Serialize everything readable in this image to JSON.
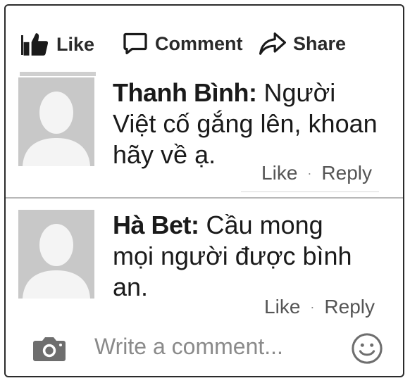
{
  "actions": {
    "like_label": "Like",
    "comment_label": "Comment",
    "share_label": "Share"
  },
  "comments": [
    {
      "author": "Thanh Bình:",
      "text": "Người Việt cố gắng lên, khoan hãy về ạ.",
      "like_label": "Like",
      "separator": "·",
      "reply_label": "Reply"
    },
    {
      "author": "Hà Bet:",
      "text": "Cầu mong mọi người được bình an.",
      "like_label": "Like",
      "separator": "·",
      "reply_label": "Reply"
    }
  ],
  "composer": {
    "placeholder": "Write a comment..."
  },
  "colors": {
    "text": "#1a1a1a",
    "muted": "#8a8a8a",
    "avatar_bg": "#c8c8c8",
    "avatar_fg": "#f4f4f4",
    "divider": "#b8b8b8"
  },
  "icons": [
    "thumbs-up-icon",
    "comment-bubble-icon",
    "share-arrow-icon",
    "camera-icon",
    "smiley-icon",
    "avatar-silhouette-icon"
  ]
}
